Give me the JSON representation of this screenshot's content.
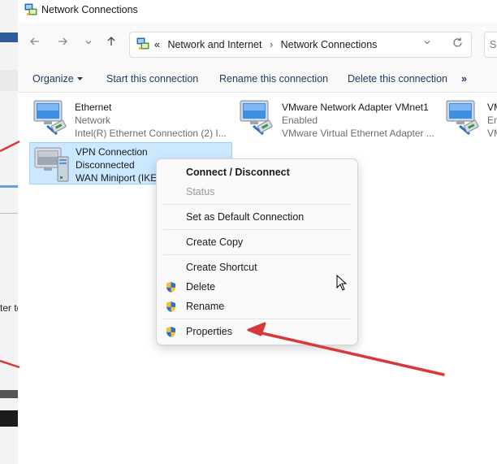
{
  "window": {
    "title": "Network Connections"
  },
  "background_window": {
    "partial_text": "ter to"
  },
  "navigation": {
    "back_icon": "arrow-left-icon",
    "forward_icon": "arrow-right-icon",
    "recent_icon": "chevron-down-icon",
    "up_icon": "arrow-up-icon"
  },
  "address": {
    "prefix": "«",
    "crumbs": [
      "Network and Internet",
      "Network Connections"
    ],
    "separator": "›",
    "search_placeholder": "Se"
  },
  "commands": {
    "organize": "Organize",
    "start": "Start this connection",
    "rename": "Rename this connection",
    "delete": "Delete this connection",
    "more": "»"
  },
  "connections": [
    {
      "name": "Ethernet",
      "status": "Network",
      "device": "Intel(R) Ethernet Connection (2) I..."
    },
    {
      "name": "VMware Network Adapter VMnet1",
      "status": "Enabled",
      "device": "VMware Virtual Ethernet Adapter ..."
    },
    {
      "name": "VM",
      "status": "En",
      "device": "VM"
    },
    {
      "name": "VPN Connection",
      "status": "Disconnected",
      "device": "WAN Miniport (IKE"
    }
  ],
  "context_menu": {
    "items": [
      {
        "label": "Connect / Disconnect",
        "bold": true
      },
      {
        "label": "Status",
        "disabled": true
      },
      {
        "label": "Set as Default Connection"
      },
      {
        "label": "Create Copy"
      },
      {
        "label": "Create Shortcut"
      },
      {
        "label": "Delete",
        "icon": "uac-shield-icon"
      },
      {
        "label": "Rename",
        "icon": "uac-shield-icon"
      },
      {
        "label": "Properties",
        "icon": "uac-shield-icon"
      }
    ]
  },
  "colors": {
    "selection_bg": "#cce8ff",
    "selection_border": "#99d1ff",
    "annotation_arrow": "#d9383a",
    "command_text": "#1f3b63"
  }
}
